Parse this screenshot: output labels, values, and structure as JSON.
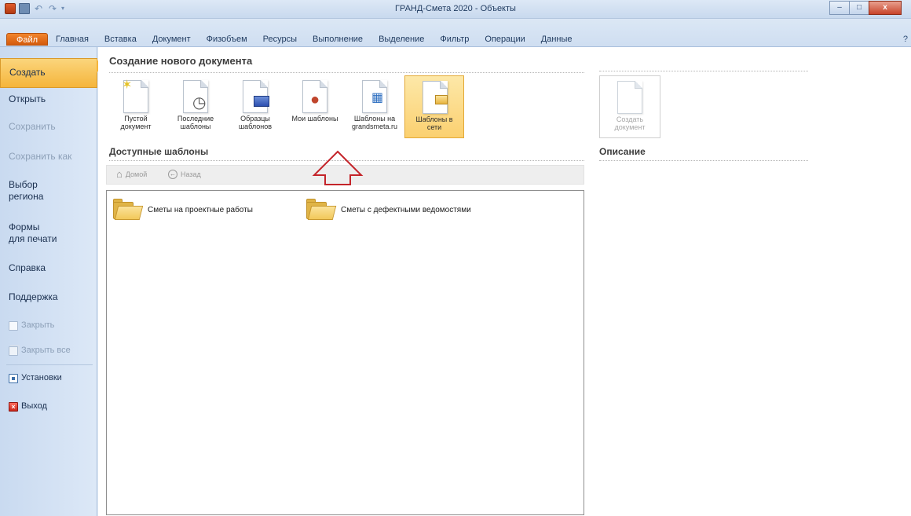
{
  "window": {
    "title": "ГРАНД-Смета 2020 - Объекты",
    "controls": {
      "minimize": "–",
      "maximize": "□",
      "close": "x"
    }
  },
  "qat": {
    "undo": "↶",
    "redo": "↷",
    "dropdown": "▾"
  },
  "ribbon": {
    "tabs": [
      "Файл",
      "Главная",
      "Вставка",
      "Документ",
      "Физобъем",
      "Ресурсы",
      "Выполнение",
      "Выделение",
      "Фильтр",
      "Операции",
      "Данные"
    ],
    "help": "?"
  },
  "nav": {
    "items": [
      {
        "label": "Создать",
        "state": "selected"
      },
      {
        "label": "Открыть",
        "state": "normal"
      },
      {
        "label": "Сохранить",
        "state": "disabled"
      },
      {
        "label": "Сохранить как",
        "state": "disabled"
      },
      {
        "label": "Выбор\nрегиона",
        "state": "normal"
      },
      {
        "label": "Формы\nдля печати",
        "state": "normal"
      },
      {
        "label": "Справка",
        "state": "normal"
      },
      {
        "label": "Поддержка",
        "state": "normal"
      }
    ],
    "small_items": [
      {
        "label": "Закрыть",
        "icon": "document-icon",
        "state": "disabled"
      },
      {
        "label": "Закрыть все",
        "icon": "documents-icon",
        "state": "disabled"
      },
      {
        "label": "Установки",
        "icon": "settings-icon",
        "state": "normal"
      },
      {
        "label": "Выход",
        "icon": "exit-icon",
        "state": "normal"
      }
    ]
  },
  "main": {
    "section_title": "Создание нового документа",
    "templates": [
      {
        "label": "Пустой\nдокумент",
        "icon": "blank-document-icon",
        "selected": false
      },
      {
        "label": "Последние\nшаблоны",
        "icon": "recent-templates-icon",
        "selected": false
      },
      {
        "label": "Образцы\nшаблонов",
        "icon": "sample-templates-icon",
        "selected": false
      },
      {
        "label": "Мои шаблоны",
        "icon": "my-templates-icon",
        "selected": false
      },
      {
        "label": "Шаблоны на\ngrandsmeta.ru",
        "icon": "web-templates-icon",
        "selected": false
      },
      {
        "label": "Шаблоны в\nсети",
        "icon": "network-templates-icon",
        "selected": true
      }
    ],
    "available_title": "Доступные шаблоны",
    "breadcrumb": {
      "home": "Домой",
      "back": "Назад"
    },
    "folders": [
      {
        "label": "Сметы на проектные работы"
      },
      {
        "label": "Сметы с дефектными ведомостями"
      }
    ]
  },
  "right": {
    "create_button": "Создать\nдокумент",
    "description_title": "Описание"
  },
  "colors": {
    "file_tab": "#e46d1a",
    "selection": "#f5b53b",
    "arrow": "#c4242a"
  }
}
